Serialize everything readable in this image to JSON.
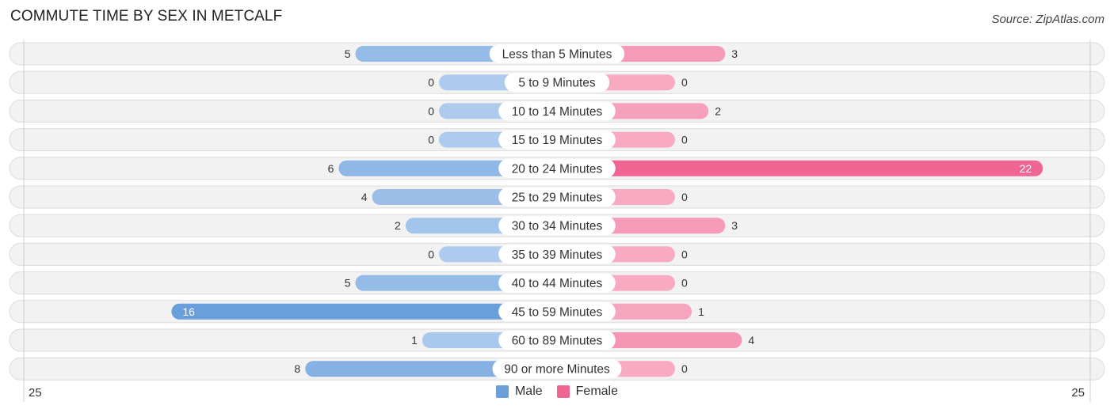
{
  "title": "COMMUTE TIME BY SEX IN METCALF",
  "source": "Source: ZipAtlas.com",
  "colors": {
    "male_strong": "#6a9fdb",
    "male_light": "#aecbee",
    "female_strong": "#f06592",
    "female_light": "#f7aac2",
    "row_bg": "#f2f2f2",
    "row_border": "#dcdcdc"
  },
  "legend": [
    {
      "label": "Male",
      "color": "#6a9fdb"
    },
    {
      "label": "Female",
      "color": "#f06592"
    }
  ],
  "axis": {
    "left_label": "25",
    "right_label": "25"
  },
  "chart_data": {
    "type": "bar",
    "orientation": "horizontal-diverging",
    "title": "COMMUTE TIME BY SEX IN METCALF",
    "xlabel": "",
    "ylabel": "",
    "xlim": [
      -25,
      25
    ],
    "grid": false,
    "legend_position": "bottom-center",
    "categories": [
      "Less than 5 Minutes",
      "5 to 9 Minutes",
      "10 to 14 Minutes",
      "15 to 19 Minutes",
      "20 to 24 Minutes",
      "25 to 29 Minutes",
      "30 to 34 Minutes",
      "35 to 39 Minutes",
      "40 to 44 Minutes",
      "45 to 59 Minutes",
      "60 to 89 Minutes",
      "90 or more Minutes"
    ],
    "series": [
      {
        "name": "Male",
        "values": [
          5,
          0,
          0,
          0,
          6,
          4,
          2,
          0,
          5,
          16,
          1,
          8
        ]
      },
      {
        "name": "Female",
        "values": [
          3,
          0,
          2,
          0,
          22,
          0,
          3,
          0,
          0,
          1,
          4,
          0
        ]
      }
    ]
  }
}
